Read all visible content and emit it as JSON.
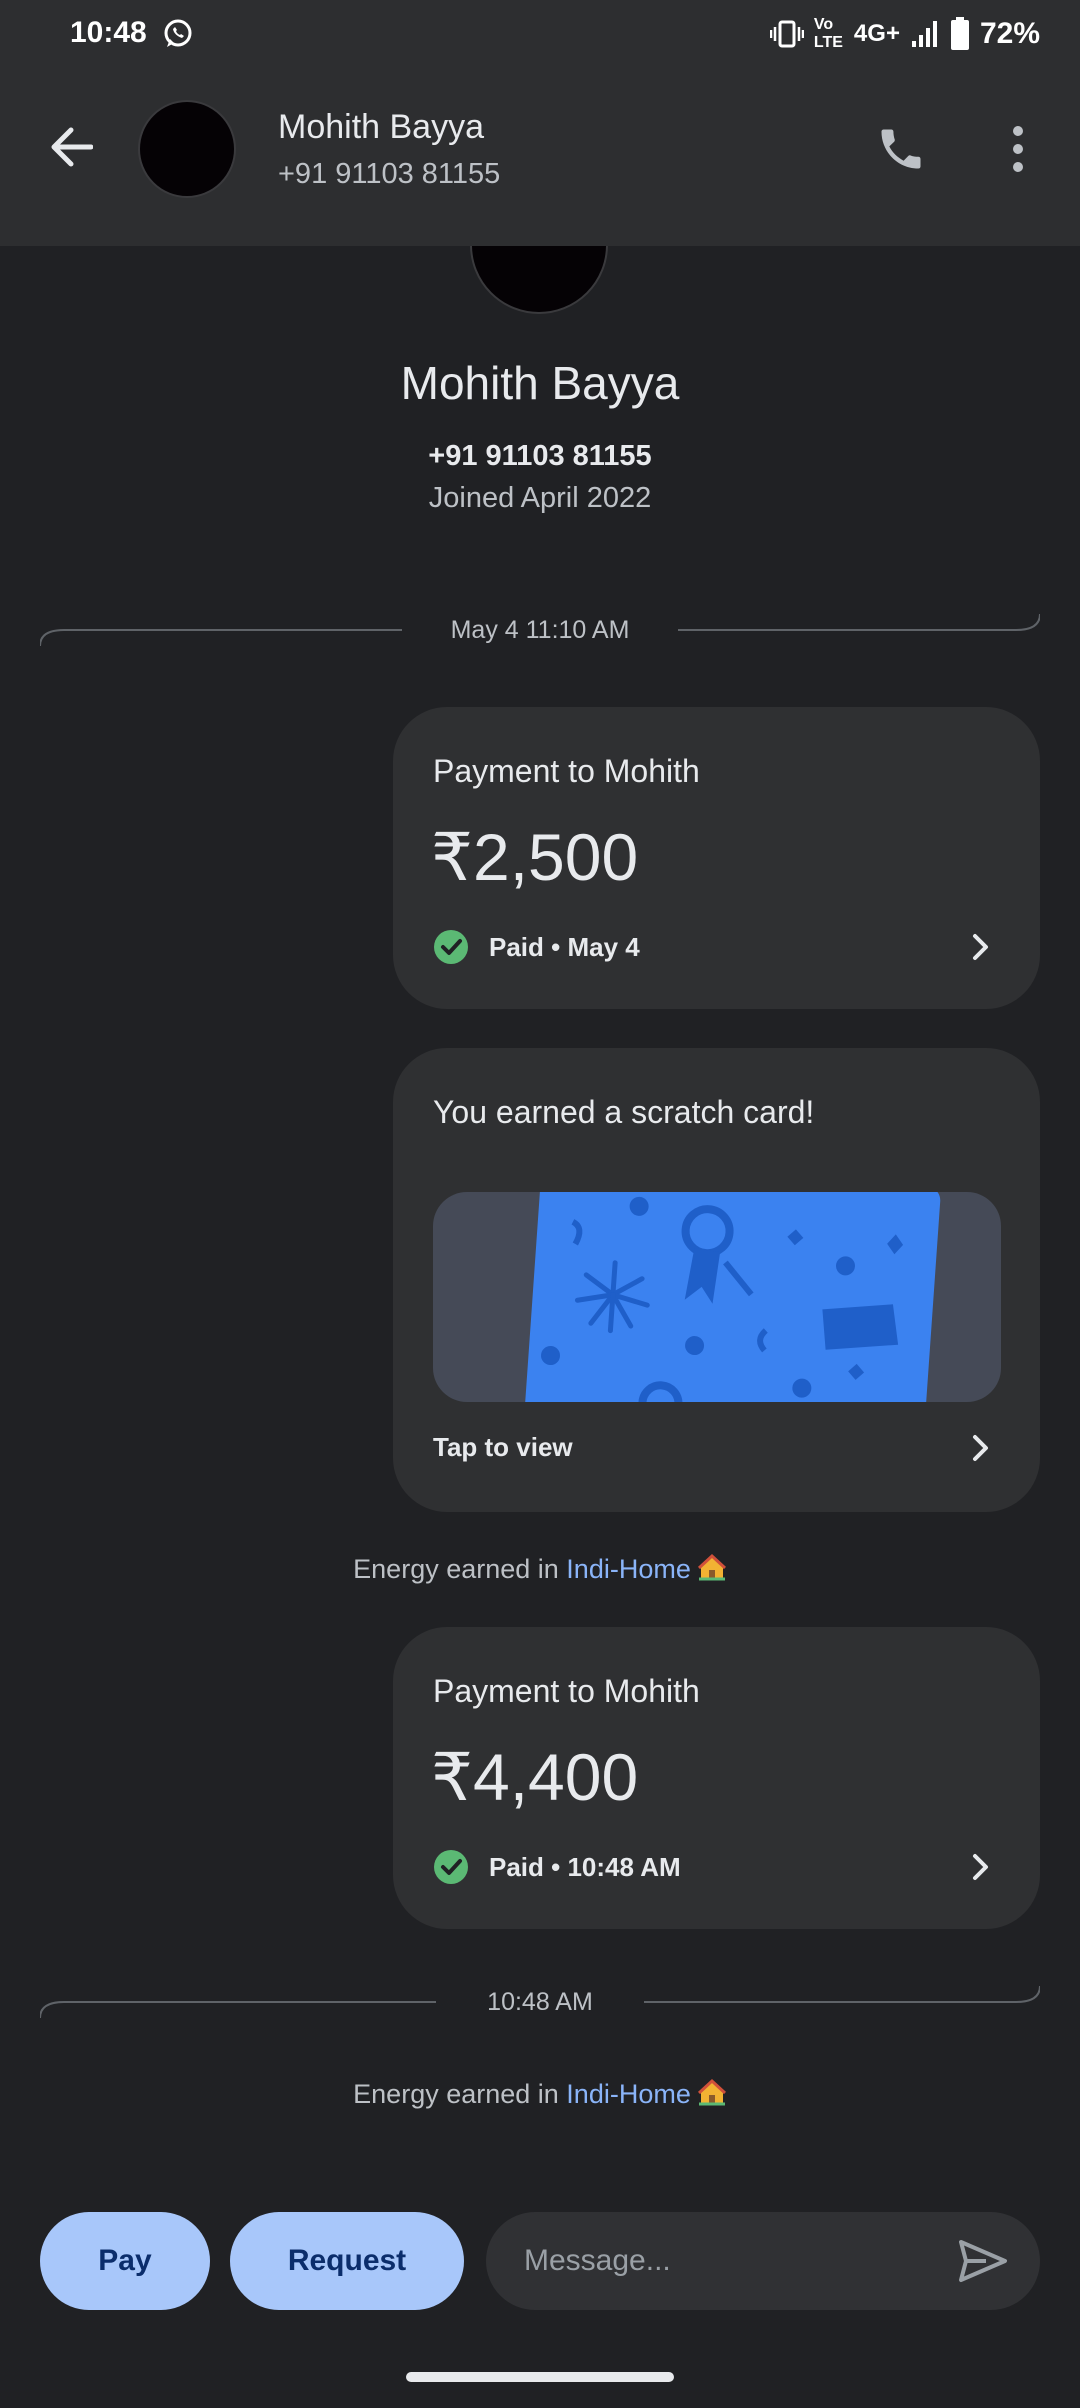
{
  "status_bar": {
    "time": "10:48",
    "volte": "Vo LTE",
    "network": "4G+",
    "battery_pct": "72%",
    "battery_level": 0.72
  },
  "header": {
    "name": "Mohith Bayya",
    "phone": "+91 91103 81155"
  },
  "profile": {
    "name": "Mohith Bayya",
    "phone": "+91 91103 81155",
    "joined": "Joined April 2022"
  },
  "timeline": {
    "separator1": "May 4 11:10 AM",
    "payment1": {
      "title": "Payment to Mohith",
      "amount": "₹2,500",
      "status": "Paid • May 4"
    },
    "scratch": {
      "title": "You earned a scratch card!",
      "action": "Tap to view"
    },
    "energy1": {
      "prefix": "Energy earned in ",
      "link": "Indi-Home"
    },
    "payment2": {
      "title": "Payment to Mohith",
      "amount": "₹4,400",
      "status": "Paid • 10:48 AM"
    },
    "separator2": "10:48 AM",
    "energy2": {
      "prefix": "Energy earned in ",
      "link": "Indi-Home"
    }
  },
  "bottom_bar": {
    "pay_label": "Pay",
    "request_label": "Request",
    "message_placeholder": "Message..."
  },
  "colors": {
    "background": "#202124",
    "card": "#2f3032",
    "accent_pill": "#a8c7fa",
    "link": "#8ab4f8",
    "success": "#5bb974",
    "scratch_card": "#3b82f0"
  }
}
